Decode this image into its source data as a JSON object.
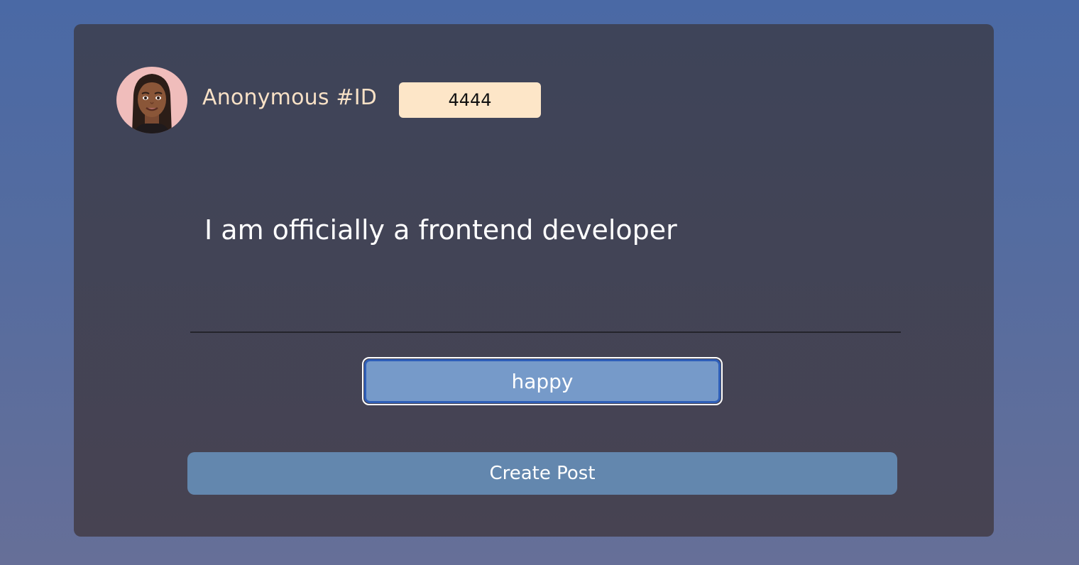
{
  "author": {
    "avatar_icon": "memoji-avatar-icon",
    "id_label": "Anonymous #ID",
    "id_value": "4444"
  },
  "post": {
    "text": "I am officially a frontend developer"
  },
  "mood": {
    "value": "happy"
  },
  "actions": {
    "create_label": "Create Post"
  },
  "colors": {
    "background_top": "#4a69a5",
    "card": "#3e4459",
    "id_field": "#fde6c8",
    "label": "#f8e1c6",
    "mood_field": "#769ac9",
    "mood_focus_border": "#2f5fb9",
    "button": "#6387ae"
  }
}
